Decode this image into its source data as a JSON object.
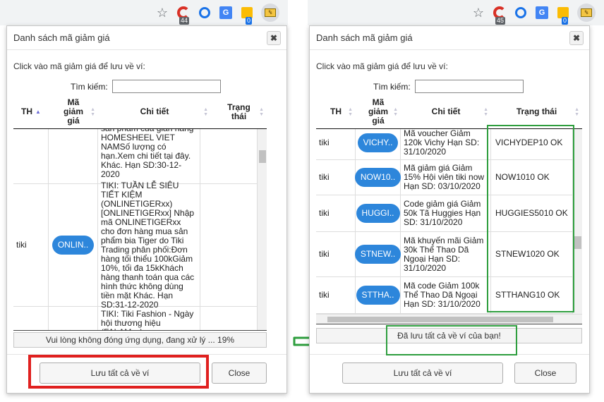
{
  "left": {
    "toolbar": {
      "badge_red": "44",
      "badge_blue": "0"
    },
    "title": "Danh sách mã giảm giá",
    "close_x": "✖",
    "hint": "Click vào mã giảm giá để lưu về ví:",
    "search": {
      "label": "Tìm kiếm:",
      "value": ""
    },
    "headers": {
      "th": "TH",
      "code": "Mã giảm giá",
      "detail": "Chi tiết",
      "status": "Trạng thái"
    },
    "rows": [
      {
        "th": "",
        "code": "",
        "detail": "sản phẩm của gian hàng HOMESHEEL VIET NAMSố lượng có hạn.Xem chi tiết tại đây. Khác. Hạn SD:30-12-2020",
        "status": ""
      },
      {
        "th": "tiki",
        "code": "ONLIN..",
        "detail": "TIKI: TUẦN LỄ SIÊU TIẾT KIỆM (ONLINETIGERxx) [ONLINETIGERxx] Nhập mã ONLINETIGERxx cho đơn hàng mua sản phẩm bia Tiger do Tiki Trading phân phối:Đơn hàng tối thiểu 100kGiảm 10%, tối đa 15kKhách hàng thanh toán qua các hình thức không dùng tiền mặt Khác. Hạn SD:31-12-2020",
        "status": ""
      },
      {
        "th": "",
        "code": "",
        "detail": "TIKI: Tiki Fashion - Ngày hội thương hiệu (FALAMxx)",
        "status": ""
      }
    ],
    "status_text": "Vui lòng không đóng ứng dụng, đang xử lý ... 19%",
    "save_all": "Lưu tất cả về ví",
    "close": "Close"
  },
  "right": {
    "toolbar": {
      "badge_red": "45",
      "badge_blue": "0"
    },
    "title": "Danh sách mã giảm giá",
    "close_x": "✖",
    "hint": "Click vào mã giảm giá để lưu về ví:",
    "search": {
      "label": "Tìm kiếm:",
      "value": ""
    },
    "headers": {
      "th": "TH",
      "code": "Mã giảm giá",
      "detail": "Chi tiết",
      "status": "Trạng thái"
    },
    "rows": [
      {
        "th": "tiki",
        "code": "VICHY..",
        "detail": "Mã voucher Giảm 120k Vichy Hạn SD: 31/10/2020",
        "status": "VICHYDEP10 OK"
      },
      {
        "th": "tiki",
        "code": "NOW10..",
        "detail": "Mã giảm giá Giảm 15% Hội viên tiki now Hạn SD: 03/10/2020",
        "status": "NOW1010 OK"
      },
      {
        "th": "tiki",
        "code": "HUGGI..",
        "detail": "Code giảm giá Giảm 50k Tã Huggies Hạn SD: 31/10/2020",
        "status": "HUGGIES5010 OK"
      },
      {
        "th": "tiki",
        "code": "STNEW..",
        "detail": "Mã khuyến mãi Giảm 30k Thể Thao Dã Ngoại Hạn SD: 31/10/2020",
        "status": "STNEW1020 OK"
      },
      {
        "th": "tiki",
        "code": "STTHA..",
        "detail": "Mã code Giảm 100k Thể Thao Dã Ngoại Hạn SD: 31/10/2020",
        "status": "STTHANG10 OK"
      }
    ],
    "status_text": "Đã lưu tất cả về ví của bạn!",
    "save_all": "Lưu tất cả về ví",
    "close": "Close"
  },
  "colors": {
    "highlight_red": "#e0201f",
    "highlight_green": "#2e9e3e",
    "pill_blue": "#2d86db"
  }
}
